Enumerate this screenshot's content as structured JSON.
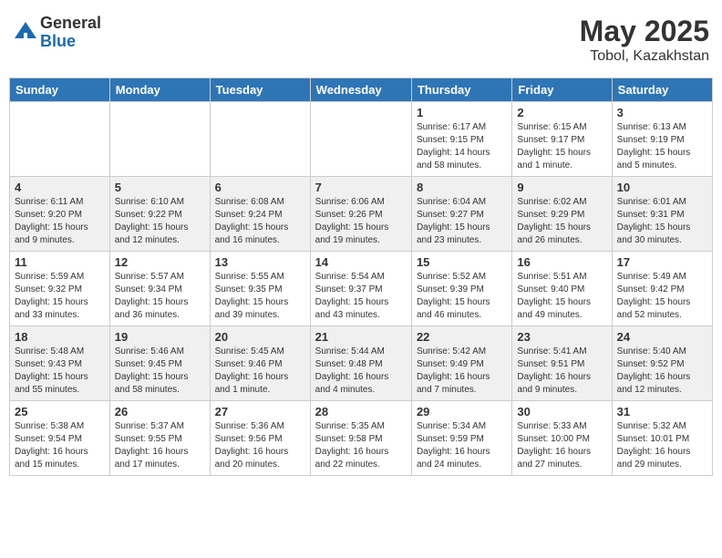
{
  "header": {
    "logo_general": "General",
    "logo_blue": "Blue",
    "month": "May 2025",
    "location": "Tobol, Kazakhstan"
  },
  "weekdays": [
    "Sunday",
    "Monday",
    "Tuesday",
    "Wednesday",
    "Thursday",
    "Friday",
    "Saturday"
  ],
  "weeks": [
    [
      {
        "day": "",
        "info": ""
      },
      {
        "day": "",
        "info": ""
      },
      {
        "day": "",
        "info": ""
      },
      {
        "day": "",
        "info": ""
      },
      {
        "day": "1",
        "info": "Sunrise: 6:17 AM\nSunset: 9:15 PM\nDaylight: 14 hours\nand 58 minutes."
      },
      {
        "day": "2",
        "info": "Sunrise: 6:15 AM\nSunset: 9:17 PM\nDaylight: 15 hours\nand 1 minute."
      },
      {
        "day": "3",
        "info": "Sunrise: 6:13 AM\nSunset: 9:19 PM\nDaylight: 15 hours\nand 5 minutes."
      }
    ],
    [
      {
        "day": "4",
        "info": "Sunrise: 6:11 AM\nSunset: 9:20 PM\nDaylight: 15 hours\nand 9 minutes."
      },
      {
        "day": "5",
        "info": "Sunrise: 6:10 AM\nSunset: 9:22 PM\nDaylight: 15 hours\nand 12 minutes."
      },
      {
        "day": "6",
        "info": "Sunrise: 6:08 AM\nSunset: 9:24 PM\nDaylight: 15 hours\nand 16 minutes."
      },
      {
        "day": "7",
        "info": "Sunrise: 6:06 AM\nSunset: 9:26 PM\nDaylight: 15 hours\nand 19 minutes."
      },
      {
        "day": "8",
        "info": "Sunrise: 6:04 AM\nSunset: 9:27 PM\nDaylight: 15 hours\nand 23 minutes."
      },
      {
        "day": "9",
        "info": "Sunrise: 6:02 AM\nSunset: 9:29 PM\nDaylight: 15 hours\nand 26 minutes."
      },
      {
        "day": "10",
        "info": "Sunrise: 6:01 AM\nSunset: 9:31 PM\nDaylight: 15 hours\nand 30 minutes."
      }
    ],
    [
      {
        "day": "11",
        "info": "Sunrise: 5:59 AM\nSunset: 9:32 PM\nDaylight: 15 hours\nand 33 minutes."
      },
      {
        "day": "12",
        "info": "Sunrise: 5:57 AM\nSunset: 9:34 PM\nDaylight: 15 hours\nand 36 minutes."
      },
      {
        "day": "13",
        "info": "Sunrise: 5:55 AM\nSunset: 9:35 PM\nDaylight: 15 hours\nand 39 minutes."
      },
      {
        "day": "14",
        "info": "Sunrise: 5:54 AM\nSunset: 9:37 PM\nDaylight: 15 hours\nand 43 minutes."
      },
      {
        "day": "15",
        "info": "Sunrise: 5:52 AM\nSunset: 9:39 PM\nDaylight: 15 hours\nand 46 minutes."
      },
      {
        "day": "16",
        "info": "Sunrise: 5:51 AM\nSunset: 9:40 PM\nDaylight: 15 hours\nand 49 minutes."
      },
      {
        "day": "17",
        "info": "Sunrise: 5:49 AM\nSunset: 9:42 PM\nDaylight: 15 hours\nand 52 minutes."
      }
    ],
    [
      {
        "day": "18",
        "info": "Sunrise: 5:48 AM\nSunset: 9:43 PM\nDaylight: 15 hours\nand 55 minutes."
      },
      {
        "day": "19",
        "info": "Sunrise: 5:46 AM\nSunset: 9:45 PM\nDaylight: 15 hours\nand 58 minutes."
      },
      {
        "day": "20",
        "info": "Sunrise: 5:45 AM\nSunset: 9:46 PM\nDaylight: 16 hours\nand 1 minute."
      },
      {
        "day": "21",
        "info": "Sunrise: 5:44 AM\nSunset: 9:48 PM\nDaylight: 16 hours\nand 4 minutes."
      },
      {
        "day": "22",
        "info": "Sunrise: 5:42 AM\nSunset: 9:49 PM\nDaylight: 16 hours\nand 7 minutes."
      },
      {
        "day": "23",
        "info": "Sunrise: 5:41 AM\nSunset: 9:51 PM\nDaylight: 16 hours\nand 9 minutes."
      },
      {
        "day": "24",
        "info": "Sunrise: 5:40 AM\nSunset: 9:52 PM\nDaylight: 16 hours\nand 12 minutes."
      }
    ],
    [
      {
        "day": "25",
        "info": "Sunrise: 5:38 AM\nSunset: 9:54 PM\nDaylight: 16 hours\nand 15 minutes."
      },
      {
        "day": "26",
        "info": "Sunrise: 5:37 AM\nSunset: 9:55 PM\nDaylight: 16 hours\nand 17 minutes."
      },
      {
        "day": "27",
        "info": "Sunrise: 5:36 AM\nSunset: 9:56 PM\nDaylight: 16 hours\nand 20 minutes."
      },
      {
        "day": "28",
        "info": "Sunrise: 5:35 AM\nSunset: 9:58 PM\nDaylight: 16 hours\nand 22 minutes."
      },
      {
        "day": "29",
        "info": "Sunrise: 5:34 AM\nSunset: 9:59 PM\nDaylight: 16 hours\nand 24 minutes."
      },
      {
        "day": "30",
        "info": "Sunrise: 5:33 AM\nSunset: 10:00 PM\nDaylight: 16 hours\nand 27 minutes."
      },
      {
        "day": "31",
        "info": "Sunrise: 5:32 AM\nSunset: 10:01 PM\nDaylight: 16 hours\nand 29 minutes."
      }
    ]
  ]
}
